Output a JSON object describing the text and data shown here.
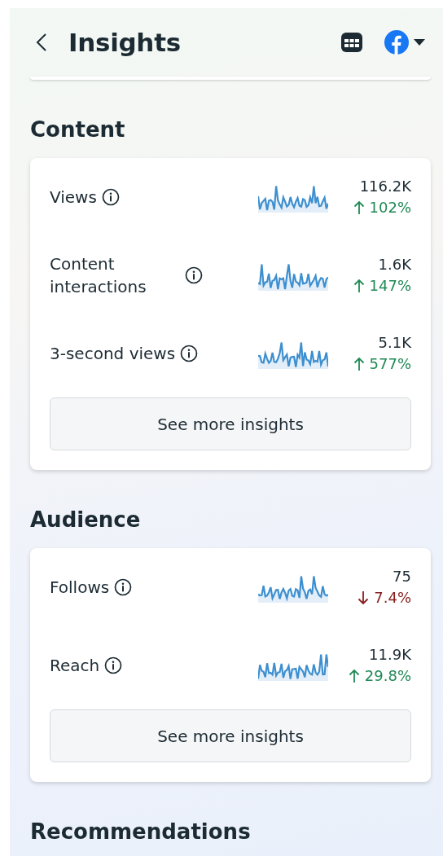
{
  "header": {
    "title": "Insights"
  },
  "sections": [
    {
      "title": "Content",
      "metrics": [
        {
          "kind": "up",
          "label": "Views",
          "value": "116.2K",
          "change": "102%"
        },
        {
          "kind": "up",
          "label": "Content interactions",
          "value": "1.6K",
          "change": "147%"
        },
        {
          "kind": "up",
          "label": "3-second views",
          "value": "5.1K",
          "change": "577%"
        }
      ],
      "button": "See more insights"
    },
    {
      "title": "Audience",
      "metrics": [
        {
          "kind": "down",
          "label": "Follows",
          "value": "75",
          "change": "7.4%"
        },
        {
          "kind": "up",
          "label": "Reach",
          "value": "11.9K",
          "change": "29.8%"
        }
      ],
      "button": "See more insights"
    },
    {
      "title": "Recommendations"
    }
  ]
}
